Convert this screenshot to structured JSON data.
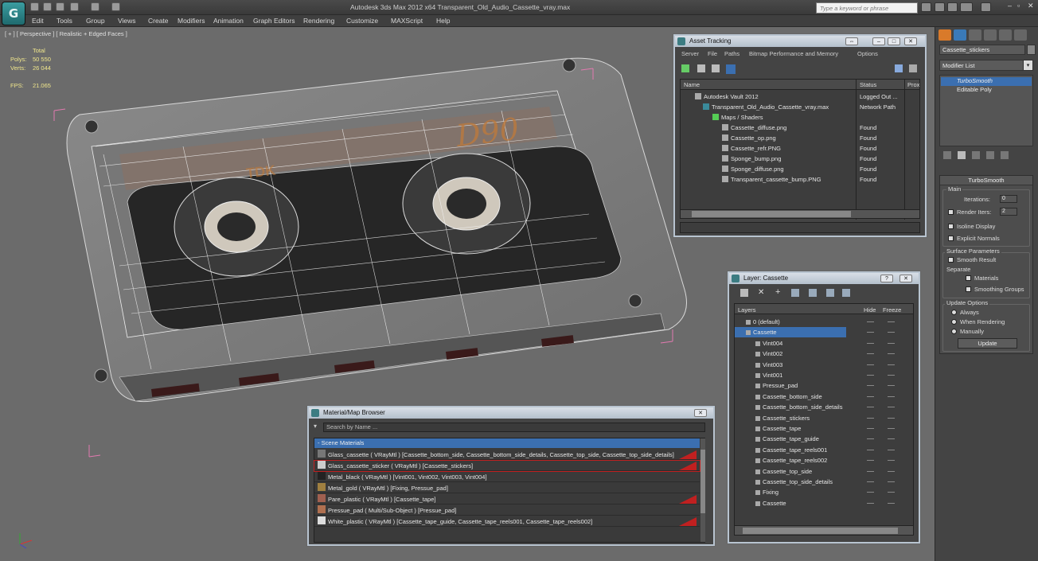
{
  "app": {
    "title": "Autodesk 3ds Max  2012 x64     Transparent_Old_Audio_Cassette_vray.max",
    "search_placeholder": "Type a keyword or phrase"
  },
  "menu": [
    "Edit",
    "Tools",
    "Group",
    "Views",
    "Create",
    "Modifiers",
    "Animation",
    "Graph Editors",
    "Rendering",
    "Customize",
    "MAXScript",
    "Help"
  ],
  "viewport": {
    "label": "[ + ] [ Perspective ] [ Realistic + Edged Faces ]",
    "stats": {
      "total_label": "Total",
      "polys_label": "Polys:",
      "polys": "50 550",
      "verts_label": "Verts:",
      "verts": "26 044",
      "fps_label": "FPS:",
      "fps": "21.065"
    },
    "label_brand": "TDK",
    "label_model": "D90"
  },
  "command_panel": {
    "object_name": "Cassette_stickers",
    "modifier_list": "Modifier List",
    "stack": [
      "TurboSmooth",
      "Editable Poly"
    ],
    "rollout_title": "TurboSmooth",
    "main_group": "Main",
    "iterations_label": "Iterations:",
    "iterations": "0",
    "render_iters_label": "Render Iters:",
    "render_iters": "2",
    "isoline": "Isoline Display",
    "explicit_normals": "Explicit Normals",
    "surface_group": "Surface Parameters",
    "smooth_result": "Smooth Result",
    "separate": "Separate",
    "materials": "Materials",
    "smoothing_groups": "Smoothing Groups",
    "update_group": "Update Options",
    "always": "Always",
    "when_rendering": "When Rendering",
    "manually": "Manually",
    "update_button": "Update"
  },
  "asset_tracking": {
    "title": "Asset Tracking",
    "menu": [
      "Server",
      "File",
      "Paths",
      "Bitmap Performance and Memory",
      "Options"
    ],
    "col_name": "Name",
    "col_status": "Status",
    "col_prox": "Prox",
    "rows": [
      {
        "name": "Autodesk Vault 2012",
        "status": "Logged Out ..."
      },
      {
        "name": "Transparent_Old_Audio_Cassette_vray.max",
        "status": "Network Path"
      },
      {
        "name": "Maps / Shaders",
        "status": ""
      },
      {
        "name": "Cassette_diffuse.png",
        "status": "Found"
      },
      {
        "name": "Cassette_op.png",
        "status": "Found"
      },
      {
        "name": "Cassette_refr.PNG",
        "status": "Found"
      },
      {
        "name": "Sponge_bump.png",
        "status": "Found"
      },
      {
        "name": "Sponge_diffuse.png",
        "status": "Found"
      },
      {
        "name": "Transparent_cassette_bump.PNG",
        "status": "Found"
      }
    ]
  },
  "layer_window": {
    "title": "Layer: Cassette",
    "col_layers": "Layers",
    "col_hide": "Hide",
    "col_freeze": "Freeze",
    "rows": [
      "0 (default)",
      "Cassette",
      "Vint004",
      "Vint002",
      "Vint003",
      "Vint001",
      "Pressue_pad",
      "Cassette_bottom_side",
      "Cassette_bottom_side_details",
      "Cassette_stickers",
      "Cassette_tape",
      "Cassette_tape_guide",
      "Cassette_tape_reels001",
      "Cassette_tape_reels002",
      "Cassette_top_side",
      "Cassette_top_side_details",
      "Fixing",
      "Cassette"
    ]
  },
  "material_browser": {
    "title": "Material/Map Browser",
    "search_placeholder": "Search by Name ...",
    "section": "- Scene Materials",
    "items": [
      "Glass_cassette  ( VRayMtl ) [Cassette_bottom_side, Cassette_bottom_side_details, Cassette_top_side, Cassette_top_side_details]",
      "Glass_cassette_sticker  ( VRayMtl ) [Cassette_stickers]",
      "Metal_black  ( VRayMtl ) [Vint001, Vint002, Vint003, Vint004]",
      "Metal_gold  ( VRayMtl ) [Fixing, Pressue_pad]",
      "Pare_plastic  ( VRayMtl ) [Cassette_tape]",
      "Pressue_pad  ( Multi/Sub-Object ) [Pressue_pad]",
      "White_plastic  ( VRayMtl ) [Cassette_tape_guide, Cassette_tape_reels001, Cassette_tape_reels002]"
    ]
  }
}
